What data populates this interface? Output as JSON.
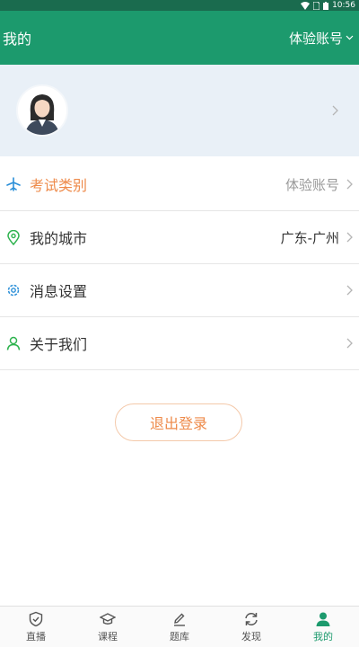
{
  "status_bar": {
    "time": "10:56"
  },
  "header": {
    "title": "我的",
    "account_label": "体验账号"
  },
  "profile": {},
  "menu": [
    {
      "label": "考试类别",
      "value": "体验账号",
      "icon": "plane-icon"
    },
    {
      "label": "我的城市",
      "value": "广东-广州",
      "icon": "location-pin-icon"
    },
    {
      "label": "消息设置",
      "value": "",
      "icon": "gear-icon"
    },
    {
      "label": "关于我们",
      "value": "",
      "icon": "person-icon"
    }
  ],
  "logout_label": "退出登录",
  "tabs": [
    {
      "label": "直播",
      "icon": "shield-icon"
    },
    {
      "label": "课程",
      "icon": "graduation-cap-icon"
    },
    {
      "label": "题库",
      "icon": "pencil-icon"
    },
    {
      "label": "发现",
      "icon": "refresh-icon"
    },
    {
      "label": "我的",
      "icon": "user-icon",
      "active": true
    }
  ],
  "colors": {
    "primary": "#1c9a6d",
    "accent": "#ee8a4a",
    "profile_bg": "#e9f0f7"
  }
}
